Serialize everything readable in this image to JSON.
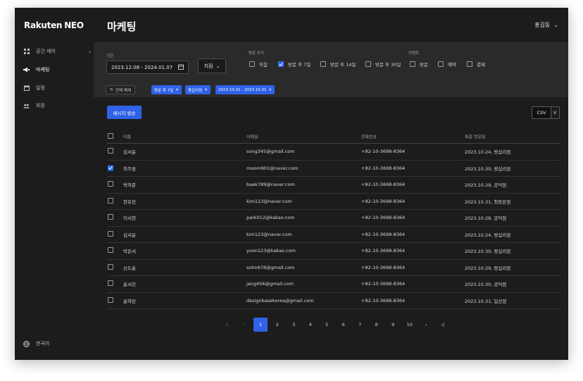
{
  "brand": {
    "logo": "Rakuten",
    "logo_suffix": "NEO"
  },
  "sidebar": {
    "items": [
      {
        "icon": "grid-icon",
        "label": "공간 제어",
        "has_chevron": true
      },
      {
        "icon": "megaphone-icon",
        "label": "마케팅",
        "active": true
      },
      {
        "icon": "calendar-icon",
        "label": "일정"
      },
      {
        "icon": "people-icon",
        "label": "회원"
      }
    ],
    "language": "한국어"
  },
  "header": {
    "title": "마케팅",
    "user": "홍길동"
  },
  "filters": {
    "period_label": "기간",
    "date_range": "2023.12.08 - 2024.01.07",
    "store_select": "지점",
    "visit_label": "방문 주기",
    "visit_options": [
      {
        "label": "처음",
        "checked": false
      },
      {
        "label": "방문 후 7일",
        "checked": true
      },
      {
        "label": "방문 후 14일",
        "checked": false
      },
      {
        "label": "방문 후 30일",
        "checked": false
      }
    ],
    "event_label": "이벤트",
    "event_options": [
      {
        "label": "방문",
        "checked": false
      },
      {
        "label": "예약",
        "checked": false
      },
      {
        "label": "결제",
        "checked": false
      }
    ],
    "reset_label": "전체 해제",
    "chips": [
      "방문 후 7일",
      "왕십리점",
      "2023.10.01 - 2023.10.31"
    ]
  },
  "actions": {
    "send_label": "메시지 발송",
    "csv_label": "CSV",
    "csv_extra": "V"
  },
  "table": {
    "headers": {
      "name": "이름",
      "email": "이메일",
      "phone": "전화번호",
      "last_visit": "최종 방문일"
    },
    "rows": [
      {
        "name": "김서윤",
        "email": "song345@gmail.com",
        "phone": "+82-10-3698-8364",
        "last_visit": "2023.10.24, 왕십리점",
        "checked": false
      },
      {
        "name": "최주원",
        "email": "moom901@naver.com",
        "phone": "+82-10-3698-8364",
        "last_visit": "2023.10.30, 왕십리점",
        "checked": true
      },
      {
        "name": "박하준",
        "email": "baek789@naver.com",
        "phone": "+82-10-3698-8364",
        "last_visit": "2023.10.29, 공덕점",
        "checked": false
      },
      {
        "name": "한유진",
        "email": "kim123@naver.com",
        "phone": "+82-10-3698-8364",
        "last_visit": "2023.10.31, 청동본점",
        "checked": false
      },
      {
        "name": "이서현",
        "email": "park012@kakao.com",
        "phone": "+82-10-3698-8364",
        "last_visit": "2023.10.28, 공덕점",
        "checked": false
      },
      {
        "name": "김서윤",
        "email": "kim123@naver.com",
        "phone": "+82-10-3698-8364",
        "last_visit": "2023.10.24, 왕십리점",
        "checked": false
      },
      {
        "name": "박은서",
        "email": "yoon123@kakao.com",
        "phone": "+82-10-3698-8364",
        "last_visit": "2023.10.30, 왕십리점",
        "checked": false
      },
      {
        "name": "신도윤",
        "email": "sohn678@gmail.com",
        "phone": "+82-10-3698-8364",
        "last_visit": "2023.10.29, 왕십리점",
        "checked": false
      },
      {
        "name": "윤서진",
        "email": "jang456@gmail.com",
        "phone": "+82-10-3698-8364",
        "last_visit": "2023.10.30, 공덕점",
        "checked": false
      },
      {
        "name": "윤하린",
        "email": "designbasekorea@gmail.com",
        "phone": "+82-10-3698-8364",
        "last_visit": "2023.10.31, 일산점",
        "checked": false
      }
    ]
  },
  "pagination": {
    "first": "|‹",
    "prev": "‹",
    "pages": [
      "1",
      "2",
      "3",
      "4",
      "5",
      "6",
      "7",
      "8",
      "9",
      "10"
    ],
    "current": "1",
    "next": "›",
    "last": "›|"
  },
  "colors": {
    "accent": "#2f62e8",
    "bg": "#1c1c1c",
    "panel": "#2a2a2a"
  }
}
